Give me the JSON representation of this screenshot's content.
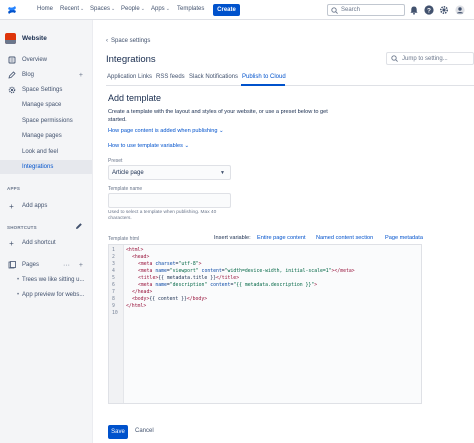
{
  "topnav": {
    "items": [
      "Home",
      "Recent",
      "Spaces",
      "People",
      "Apps",
      "Templates"
    ],
    "create_label": "Create",
    "search_placeholder": "Search",
    "brand_color": "#0052cc"
  },
  "sidebar": {
    "space_name": "Website",
    "items": [
      {
        "label": "Overview",
        "icon": "overview-icon"
      },
      {
        "label": "Blog",
        "icon": "blog-icon"
      },
      {
        "label": "Space Settings",
        "icon": "gear-icon"
      },
      {
        "label": "Manage space"
      },
      {
        "label": "Space permissions"
      },
      {
        "label": "Manage pages"
      },
      {
        "label": "Look and feel"
      },
      {
        "label": "Integrations",
        "active": true
      }
    ],
    "apps_header": "APPS",
    "add_apps": "Add apps",
    "shortcuts_header": "SHORTCUTS",
    "add_shortcut": "Add shortcut",
    "pages_label": "Pages",
    "pages": [
      "Trees we like sitting u...",
      "App preview for webs..."
    ]
  },
  "main": {
    "breadcrumb": "Space settings",
    "title": "Integrations",
    "jump_placeholder": "Jump to setting...",
    "tabs": [
      "Application Links",
      "RSS feeds",
      "Slack Notifications",
      "Publish to Cloud"
    ],
    "active_tab": "Publish to Cloud",
    "heading": "Add template",
    "description": "Create a template with the layout and styles of your website, or use a preset below to get started.",
    "help1": "How page content is added when publishing",
    "help2": "How to use template variables",
    "preset_label": "Preset",
    "preset_value": "Article page",
    "name_label": "Template name",
    "name_value": "",
    "name_hint": "Used to select a template when publishing. Max 40 characters.",
    "html_label": "Template html",
    "insert_label": "Insert variable:",
    "insert_links": [
      "Entire page content",
      "Named content section",
      "Page metadata"
    ],
    "save_label": "Save",
    "cancel_label": "Cancel"
  },
  "code": {
    "line_numbers": [
      "1",
      "2",
      "3",
      "4",
      "5",
      "6",
      "7",
      "8",
      "9",
      "10"
    ],
    "l1": "<html>",
    "l2": "<head>",
    "l3a": "<meta ",
    "l3b": "charset",
    "l3c": "=",
    "l3d": "\"utf-8\"",
    "l3e": ">",
    "l4a": "<meta ",
    "l4b": "name",
    "l4c": "=",
    "l4d": "\"viewport\"",
    "l4e": " content",
    "l4f": "=",
    "l4g": "\"width=device-width, initial-scale=1\"",
    "l4h": "></meta>",
    "l5a": "<title>",
    "l5b": "{{ metadata.title }}",
    "l5c": "</title>",
    "l6a": "<meta ",
    "l6b": "name",
    "l6c": "=",
    "l6d": "\"description\"",
    "l6e": " content",
    "l6f": "=",
    "l6g": "\"{{ metadata.description }}\"",
    "l6h": ">",
    "l7": "</head>",
    "l8a": "<body>",
    "l8b": "{{ content }}",
    "l8c": "</body>",
    "l9": "</html>"
  }
}
